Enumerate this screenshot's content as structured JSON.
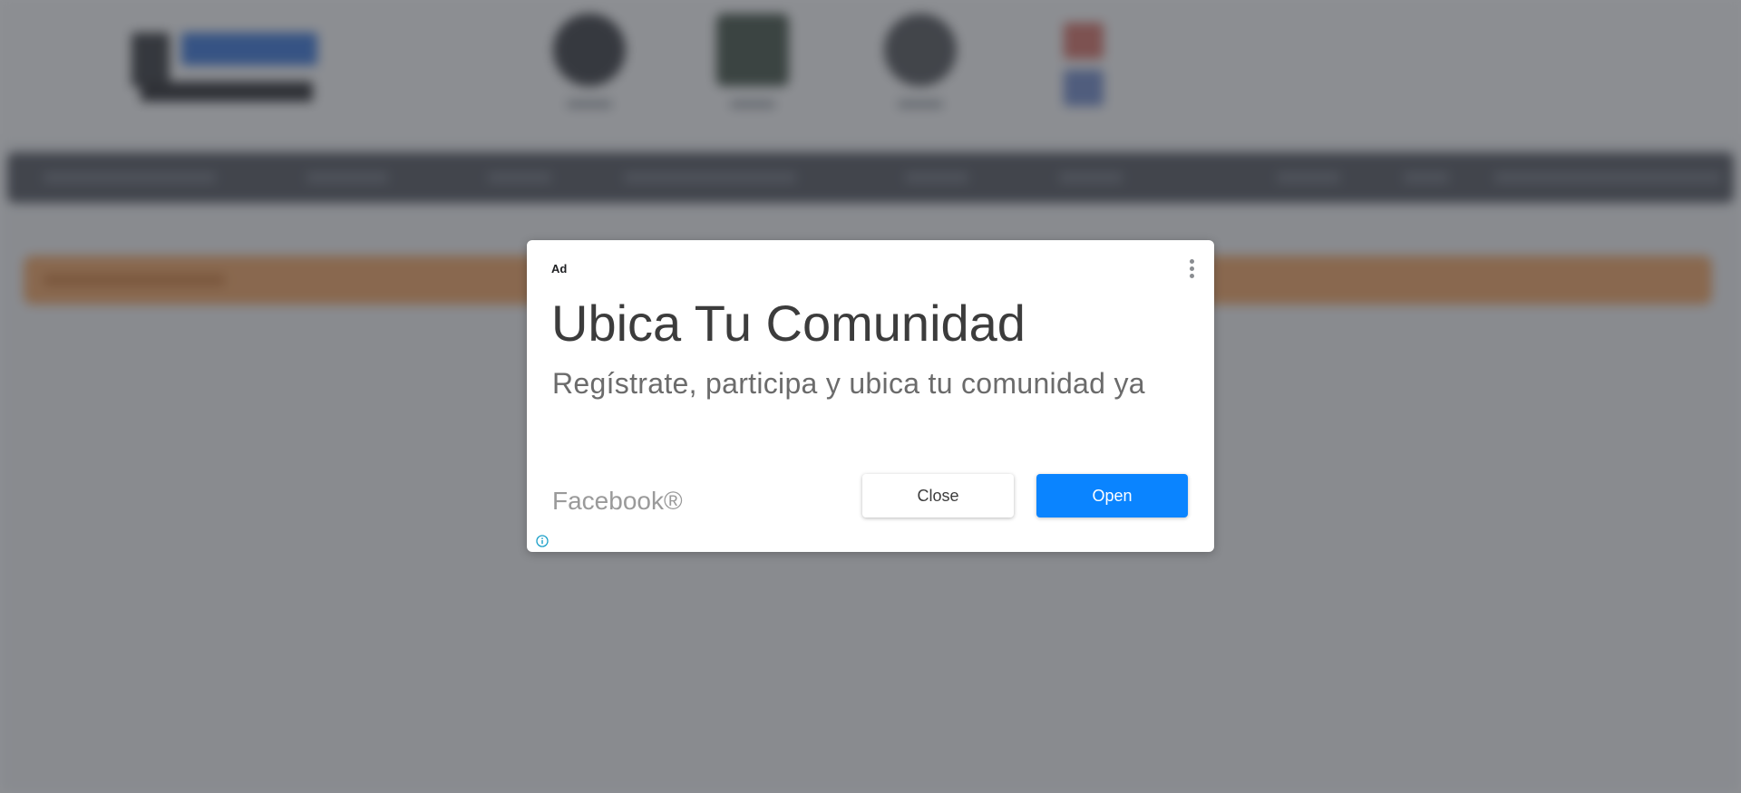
{
  "background_page": {
    "description_visible": false,
    "header_icons": [
      "chat-bubble-icon",
      "chart-icon",
      "chat-bubble-icon",
      "flag-icon"
    ],
    "colors": {
      "nav_bar": "#4a4d55",
      "banner": "#f3a15b",
      "overlay": "rgba(60,64,70,0.58)"
    }
  },
  "ad": {
    "label": "Ad",
    "headline": "Ubica Tu Comunidad",
    "body": "Regístrate, participa y ubica tu comunidad ya",
    "advertiser": "Facebook®",
    "close_label": "Close",
    "open_label": "Open",
    "menu_icon": "more-vertical-icon",
    "info_icon": "info-icon",
    "colors": {
      "open_button": "#0a84ff",
      "info_icon": "#1a9fc8"
    }
  }
}
